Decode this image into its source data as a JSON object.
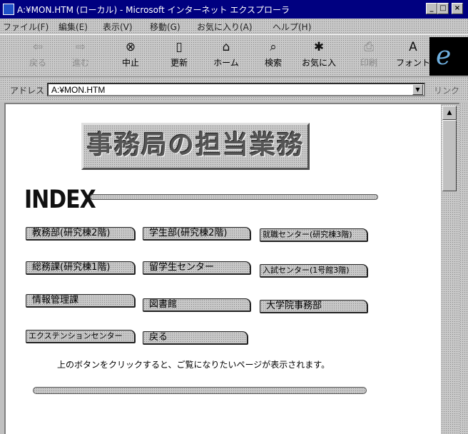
{
  "window": {
    "title": "A:¥MON.HTM (ローカル) - Microsoft インターネット エクスプローラ"
  },
  "menu": [
    "ファイル(F)",
    "編集(E)",
    "表示(V)",
    "移動(G)",
    "お気に入り(A)",
    "ヘルプ(H)"
  ],
  "toolbar": {
    "back": "戻る",
    "forward": "進む",
    "stop": "中止",
    "refresh": "更新",
    "home": "ホーム",
    "search": "検索",
    "favorites": "お気に入",
    "print": "印刷",
    "font": "フォント"
  },
  "address": {
    "label": "アドレス",
    "value": "A:¥MON.HTM",
    "links_label": "リンク"
  },
  "page": {
    "title": "事務局の担当業務",
    "index_heading": "INDEX",
    "buttons": [
      "教務部(研究棟2階)",
      "学生部(研究棟2階)",
      "就職センター(研究棟3階)",
      "総務課(研究棟1階)",
      "留学生センター",
      "入試センター(1号館3階)",
      "情報管理課",
      "図書館",
      "大学院事務部",
      "エクステンションセンター",
      "戻る"
    ],
    "instruction": "上のボタンをクリックすると、ご覧になりたいページが表示されます。"
  }
}
